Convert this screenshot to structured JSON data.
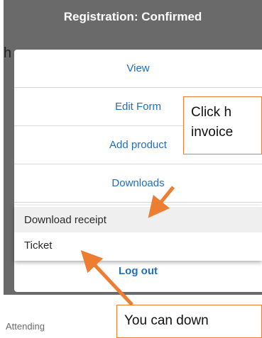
{
  "header": {
    "status_title": "Registration: Confirmed",
    "behind_letter": "h"
  },
  "menu": {
    "items": [
      {
        "label": "View"
      },
      {
        "label": "Edit Form"
      },
      {
        "label": "Add product"
      },
      {
        "label": "Downloads"
      }
    ]
  },
  "downloads_submenu": {
    "items": [
      {
        "label": "Download receipt",
        "highlighted": true
      },
      {
        "label": "Ticket",
        "highlighted": false
      }
    ]
  },
  "logout_label": "Log out",
  "footer": {
    "attending_label": "Attending"
  },
  "callouts": {
    "top_text": "Click h\ninvoice",
    "bottom_text": "You can down"
  },
  "colors": {
    "accent_link": "#1f6fbf",
    "annotation": "#ed7d31",
    "backdrop": "#6a6a6a"
  }
}
